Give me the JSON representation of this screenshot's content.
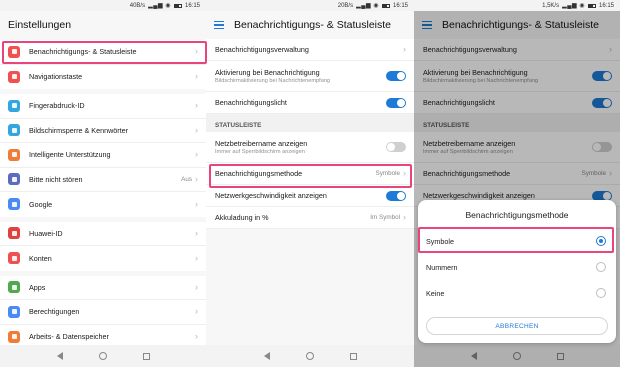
{
  "panel1": {
    "status": {
      "speed": "40B/s",
      "time": "16:15"
    },
    "title": "Einstellungen",
    "groups": [
      [
        {
          "label": "Benachrichtigungs- & Statusleiste",
          "icon": "notification-icon",
          "color": "#f0504f"
        },
        {
          "label": "Navigationstaste",
          "icon": "navigation-icon",
          "color": "#f0504f"
        }
      ],
      [
        {
          "label": "Fingerabdruck-ID",
          "icon": "fingerprint-icon",
          "color": "#33a6df"
        },
        {
          "label": "Bildschirmsperre & Kennwörter",
          "icon": "lock-icon",
          "color": "#33a6df"
        },
        {
          "label": "Intelligente Unterstützung",
          "icon": "hand-icon",
          "color": "#ef7d37"
        },
        {
          "label": "Bitte nicht stören",
          "icon": "moon-icon",
          "color": "#5c6bc0",
          "value": "Aus"
        },
        {
          "label": "Google",
          "icon": "google-icon",
          "color": "#4a8af4"
        }
      ],
      [
        {
          "label": "Huawei-ID",
          "icon": "huawei-icon",
          "color": "#e0403f"
        },
        {
          "label": "Konten",
          "icon": "account-icon",
          "color": "#f0504f"
        }
      ],
      [
        {
          "label": "Apps",
          "icon": "apps-icon",
          "color": "#4ea94f"
        },
        {
          "label": "Berechtigungen",
          "icon": "key-icon",
          "color": "#4a8af4"
        },
        {
          "label": "Arbeits- & Datenspeicher",
          "icon": "storage-icon",
          "color": "#ef7d37"
        }
      ]
    ]
  },
  "panel2": {
    "status": {
      "speed": "20B/s",
      "time": "16:15"
    },
    "title": "Benachrichtigungs- & Statusleiste",
    "rows_top": [
      {
        "label": "Benachrichtigungsverwaltung",
        "type": "chevron"
      },
      {
        "label": "Aktivierung bei Benachrichtigung",
        "sub": "Bildschirmaktivierung bei Nachrichtenempfang",
        "type": "toggle",
        "on": true
      },
      {
        "label": "Benachrichtigungslicht",
        "type": "toggle",
        "on": true
      }
    ],
    "section_label": "STATUSLEISTE",
    "rows_bottom": [
      {
        "label": "Netzbetreibername anzeigen",
        "sub": "Immer auf Sperrbildschirm anzeigen",
        "type": "toggle",
        "on": false
      },
      {
        "label": "Benachrichtigungsmethode",
        "type": "value",
        "value": "Symbole"
      },
      {
        "label": "Netzwerkgeschwindigkeit anzeigen",
        "type": "toggle",
        "on": true
      },
      {
        "label": "Akkuladung in %",
        "type": "value",
        "value": "Im Symbol"
      }
    ]
  },
  "panel3": {
    "status": {
      "speed": "1,5K/s",
      "time": "16:15"
    },
    "title": "Benachrichtigungs- & Statusleiste",
    "dialog": {
      "title": "Benachrichtigungsmethode",
      "options": [
        {
          "label": "Symbole",
          "selected": true
        },
        {
          "label": "Nummern",
          "selected": false
        },
        {
          "label": "Keine",
          "selected": false
        }
      ],
      "cancel": "ABBRECHEN"
    }
  },
  "colors": {
    "accent": "#1e7ad6",
    "highlight": "#e8457a"
  }
}
